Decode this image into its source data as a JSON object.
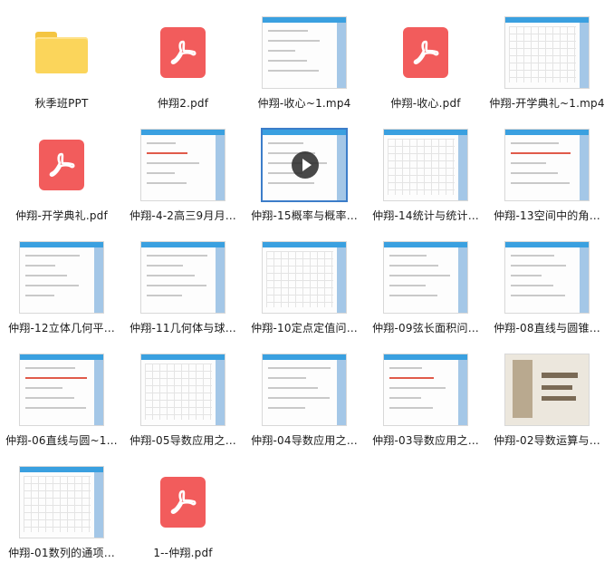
{
  "files": [
    {
      "label": "秋季班PPT",
      "kind": "folder",
      "icon": "folder-icon"
    },
    {
      "label": "仲翔2.pdf",
      "kind": "pdf",
      "icon": "pdf-icon"
    },
    {
      "label": "仲翔-收心~1.mp4",
      "kind": "video",
      "icon": "video-thumbnail"
    },
    {
      "label": "仲翔-收心.pdf",
      "kind": "pdf",
      "icon": "pdf-icon"
    },
    {
      "label": "仲翔-开学典礼~1.mp4",
      "kind": "video",
      "icon": "video-thumbnail"
    },
    {
      "label": "仲翔-开学典礼.pdf",
      "kind": "pdf",
      "icon": "pdf-icon"
    },
    {
      "label": "仲翔-4-2高三9月月…",
      "kind": "video",
      "icon": "video-thumbnail"
    },
    {
      "label": "仲翔-15概率与概率…",
      "kind": "video-selected",
      "icon": "video-thumbnail"
    },
    {
      "label": "仲翔-14统计与统计…",
      "kind": "video",
      "icon": "video-thumbnail"
    },
    {
      "label": "仲翔-13空间中的角…",
      "kind": "video",
      "icon": "video-thumbnail"
    },
    {
      "label": "仲翔-12立体几何平…",
      "kind": "video",
      "icon": "video-thumbnail"
    },
    {
      "label": "仲翔-11几何体与球…",
      "kind": "video",
      "icon": "video-thumbnail"
    },
    {
      "label": "仲翔-10定点定值问…",
      "kind": "video",
      "icon": "video-thumbnail"
    },
    {
      "label": "仲翔-09弦长面积问…",
      "kind": "video",
      "icon": "video-thumbnail"
    },
    {
      "label": "仲翔-08直线与圆锥…",
      "kind": "video",
      "icon": "video-thumbnail"
    },
    {
      "label": "仲翔-06直线与圆~1…",
      "kind": "video",
      "icon": "video-thumbnail"
    },
    {
      "label": "仲翔-05导数应用之…",
      "kind": "video",
      "icon": "video-thumbnail"
    },
    {
      "label": "仲翔-04导数应用之…",
      "kind": "video",
      "icon": "video-thumbnail"
    },
    {
      "label": "仲翔-03导数应用之…",
      "kind": "video",
      "icon": "video-thumbnail"
    },
    {
      "label": "仲翔-02导数运算与…",
      "kind": "photo",
      "icon": "video-thumbnail"
    },
    {
      "label": "仲翔-01数列的通项…",
      "kind": "video",
      "icon": "video-thumbnail"
    },
    {
      "label": "1--仲翔.pdf",
      "kind": "pdf",
      "icon": "pdf-icon"
    }
  ],
  "colors": {
    "folder": "#fbd55b",
    "pdf": "#f25c5c",
    "selection": "#3c7dc9"
  }
}
